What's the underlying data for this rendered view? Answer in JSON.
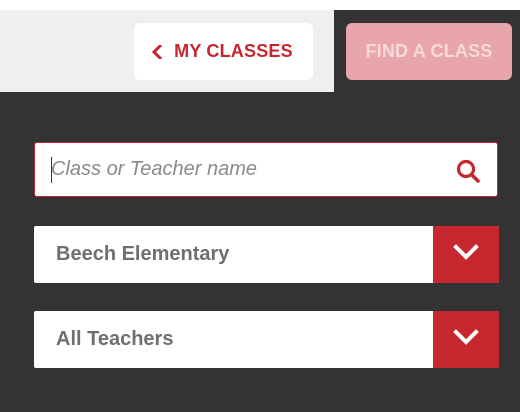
{
  "tabs": {
    "my_classes_label": "MY CLASSES",
    "find_class_label": "FIND A CLASS",
    "back_icon": "chevron-left-icon"
  },
  "search": {
    "placeholder": "Class or Teacher name",
    "value": "",
    "icon": "search-icon"
  },
  "filters": {
    "school": {
      "selected": "Beech Elementary",
      "icon": "chevron-down-icon"
    },
    "teacher": {
      "selected": "All Teachers",
      "icon": "chevron-down-icon"
    }
  },
  "colors": {
    "brand_red": "#c6262e",
    "brand_red_muted": "#e8a6aa",
    "background_dark": "#333333",
    "tab_bg_light": "#efefef",
    "text_gray": "#6f6f6f"
  }
}
